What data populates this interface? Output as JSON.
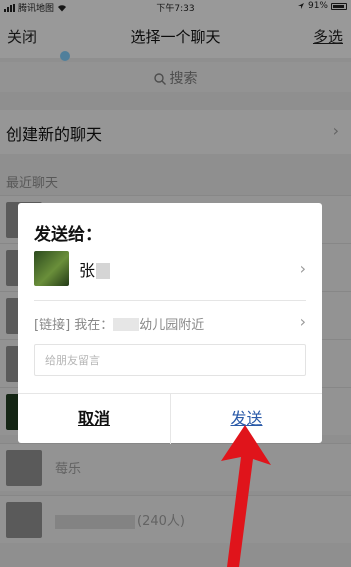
{
  "status_bar": {
    "carrier": "腾讯地图",
    "time": "下午7:33",
    "battery": "91%"
  },
  "navbar": {
    "close_label": "关闭",
    "title": "选择一个聊天",
    "multi_select_label": "多选"
  },
  "search": {
    "placeholder": "搜索"
  },
  "create_chat": {
    "label": "创建新的聊天"
  },
  "recent": {
    "section_label": "最近聊天",
    "rows": [
      {
        "name": "莓乐"
      },
      {
        "name": "(240人)"
      }
    ]
  },
  "dialog": {
    "title": "发送给：",
    "recipient_name": "张",
    "link_prefix": "[链接] 我在：",
    "link_suffix": "幼儿园附近",
    "message_placeholder": "给朋友留言",
    "cancel_label": "取消",
    "send_label": "发送"
  },
  "colors": {
    "send_blue": "#2a5aa8",
    "arrow_red": "#e0141b",
    "overlay": "rgba(0,0,0,0.35)"
  },
  "icons": [
    "wifi-icon",
    "signal-icon",
    "location-icon",
    "battery-icon",
    "search-icon",
    "chevron-right-icon",
    "red-arrow-annotation"
  ]
}
